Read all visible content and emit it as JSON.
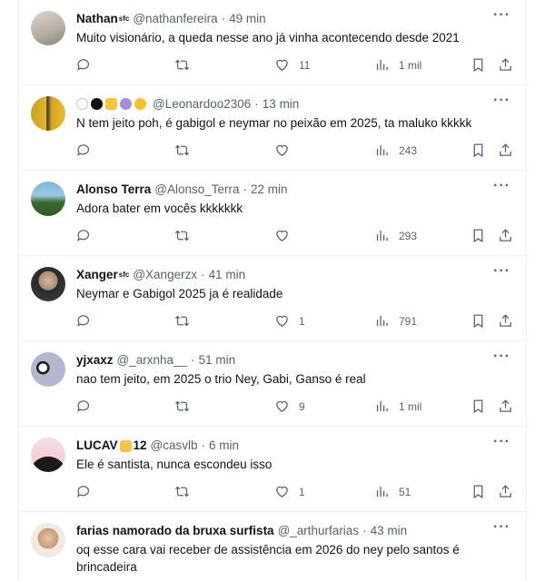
{
  "tweets": [
    {
      "name": "Nathan",
      "sup": "sfc",
      "handle": "@nathanfereira",
      "time": "49 min",
      "text": "Muito visionário, a queda nesse ano já vinha acontecendo desde 2021",
      "likes": "11",
      "views": "1 mil"
    },
    {
      "name": "",
      "handle": "@Leonardoo2306",
      "time": "13 min",
      "text": "N tem jeito poh, é gabigol e neymar no  peixão em 2025, ta maluko kkkkk",
      "likes": "",
      "views": "243"
    },
    {
      "name": "Alonso Terra",
      "handle": "@Alonso_Terra",
      "time": "22 min",
      "text": "Adora bater em vocês kkkkkkk",
      "likes": "",
      "views": "293"
    },
    {
      "name": "Xanger",
      "sup": "sfc",
      "handle": "@Xangerzx",
      "time": "41 min",
      "text": "Neymar e Gabigol 2025 ja é realidade",
      "likes": "1",
      "views": "791"
    },
    {
      "name": "yjxaxz",
      "handle": "@_arxnha__",
      "time": "51 min",
      "text": "nao tem jeito, em 2025 o trio Ney, Gabi, Ganso é real",
      "likes": "9",
      "views": "1 mil"
    },
    {
      "name": "LUCAV",
      "name_suffix": "12",
      "handle": "@casvlb",
      "time": "6 min",
      "text": "Ele é santista, nunca escondeu isso",
      "likes": "1",
      "views": "51"
    },
    {
      "name": "farias namorado da bruxa surfista",
      "handle": "@_arthurfarias",
      "time": "43 min",
      "text": "oq esse cara vai receber de assistência em 2026 do ney pelo santos é brincadeira",
      "likes": "",
      "views": ""
    }
  ],
  "more_label": "···",
  "separator": "·",
  "icons": [
    "reply-icon",
    "retweet-icon",
    "like-icon",
    "views-icon",
    "bookmark-icon",
    "share-icon",
    "more-icon"
  ]
}
